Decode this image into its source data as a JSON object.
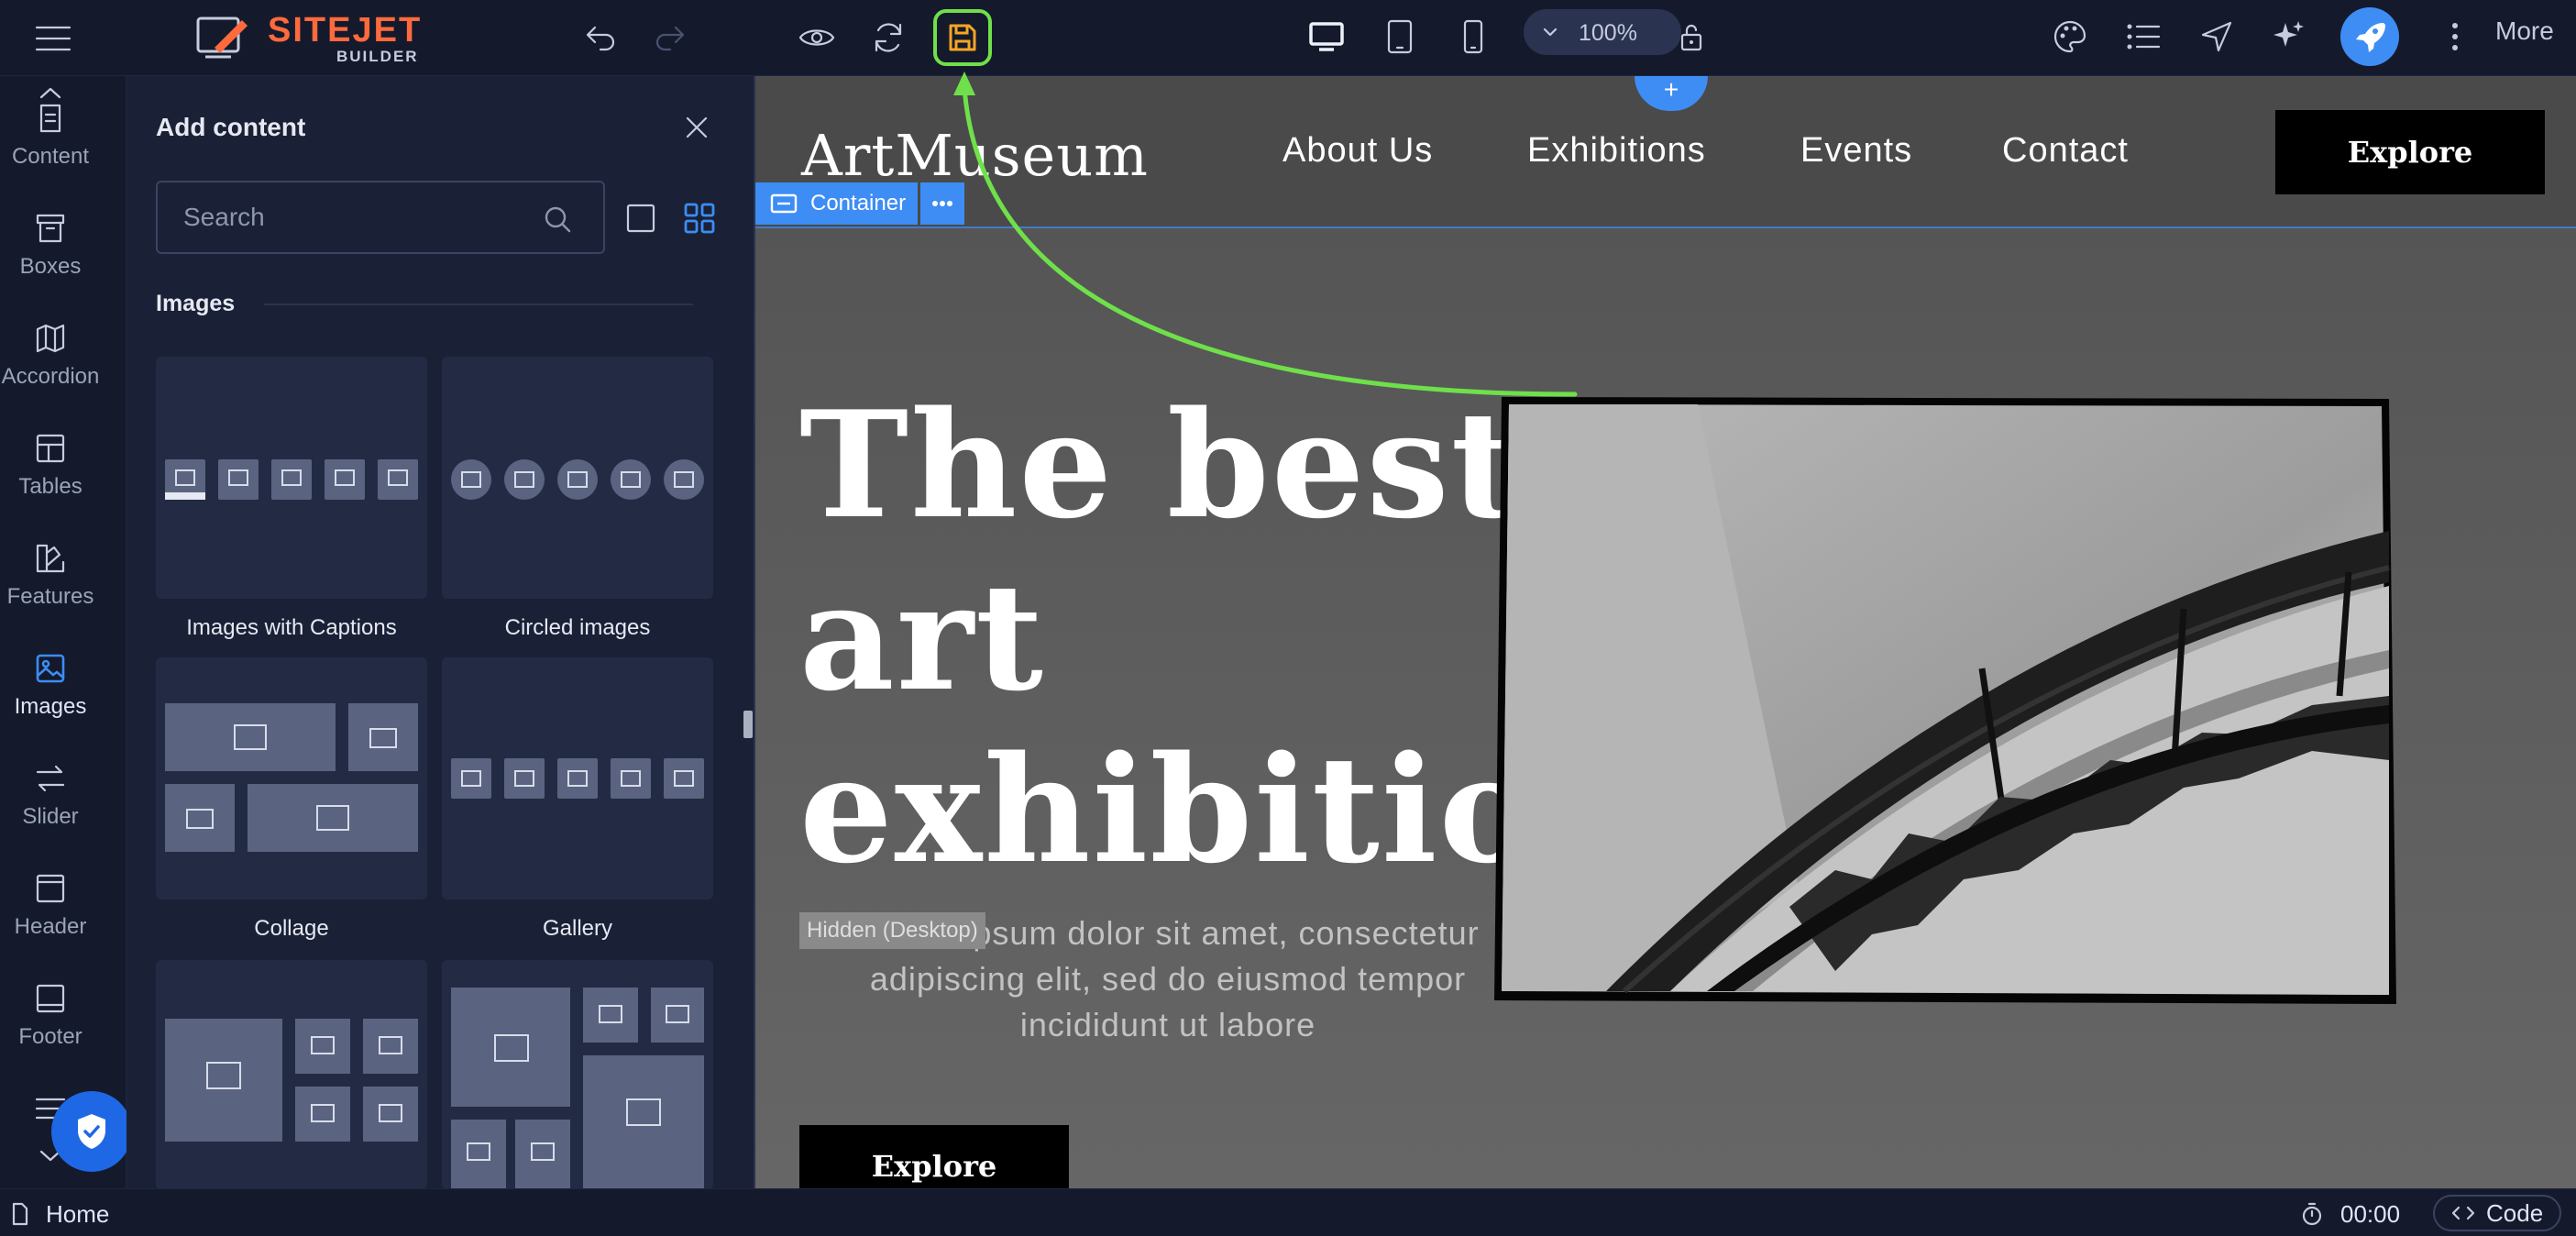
{
  "topbar": {
    "logo_text": "SITEJET",
    "logo_sub": "BUILDER",
    "zoom": "100%",
    "more_label": "More"
  },
  "iconbar": {
    "items": [
      {
        "label": "Content"
      },
      {
        "label": "Boxes"
      },
      {
        "label": "Accordion"
      },
      {
        "label": "Tables"
      },
      {
        "label": "Features"
      },
      {
        "label": "Images"
      },
      {
        "label": "Slider"
      },
      {
        "label": "Header"
      },
      {
        "label": "Footer"
      }
    ]
  },
  "panel": {
    "title": "Add content",
    "search_placeholder": "Search",
    "section_title": "Images",
    "cards": [
      {
        "label": "Images with Captions"
      },
      {
        "label": "Circled images"
      },
      {
        "label": "Collage"
      },
      {
        "label": "Gallery"
      }
    ]
  },
  "statusbar": {
    "page": "Home",
    "timer": "00:00",
    "code_label": "Code"
  },
  "site": {
    "logo": "ArtMuseum",
    "nav": [
      "About Us",
      "Exhibitions",
      "Events",
      "Contact"
    ],
    "nav_button": "Explore",
    "container_label": "Container",
    "headline_lines": [
      "The best",
      "art",
      "exhibitions"
    ],
    "hidden_label": "Hidden (Desktop)",
    "sub_lines": [
      "Lorem ipsum dolor sit amet, consectetur",
      "adipiscing elit, sed do eiusmod tempor",
      "incididunt ut labore"
    ],
    "hero_button": "Explore"
  },
  "colors": {
    "accent": "#3d8df5",
    "brand": "#ff6a3d",
    "highlight": "#6fe04a",
    "save_icon": "#f5a623"
  }
}
